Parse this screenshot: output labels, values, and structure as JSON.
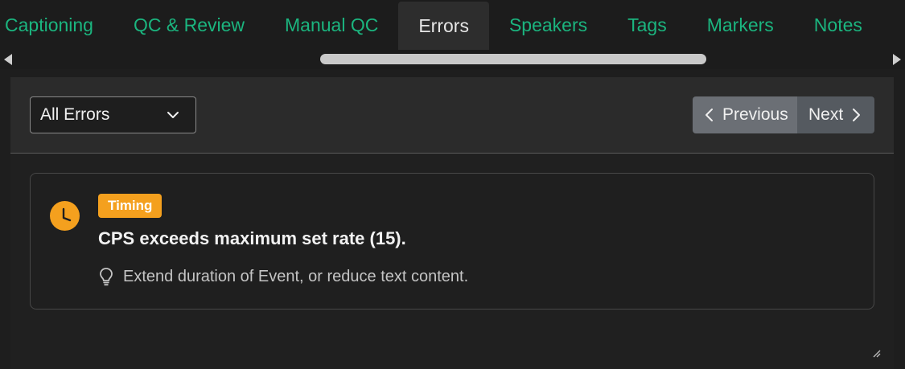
{
  "tabs": [
    {
      "label": "Captioning"
    },
    {
      "label": "QC & Review"
    },
    {
      "label": "Manual QC"
    },
    {
      "label": "Errors",
      "active": true
    },
    {
      "label": "Speakers"
    },
    {
      "label": "Tags"
    },
    {
      "label": "Markers"
    },
    {
      "label": "Notes"
    }
  ],
  "filter": {
    "selected": "All Errors",
    "icon": "chevron-down-icon"
  },
  "pager": {
    "previous_label": "Previous",
    "next_label": "Next"
  },
  "error": {
    "category": "Timing",
    "message": "CPS exceeds maximum set rate (15).",
    "suggestion": "Extend duration of Event, or reduce text content.",
    "icon": "clock-icon",
    "hint_icon": "lightbulb-icon"
  },
  "colors": {
    "accent_green": "#1bb57f",
    "timing_orange": "#f4a01e",
    "background": "#1e1e1e"
  }
}
